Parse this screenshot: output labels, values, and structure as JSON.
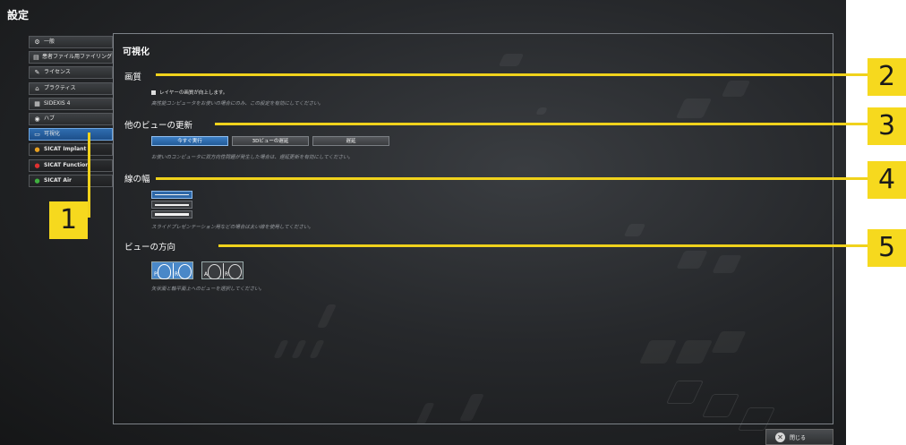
{
  "window_title": "設定",
  "sidebar": {
    "items": [
      {
        "label": "一般",
        "icon": "gear-icon"
      },
      {
        "label": "患者ファイル用ファイリング",
        "icon": "filing-icon"
      },
      {
        "label": "ライセンス",
        "icon": "license-icon"
      },
      {
        "label": "プラクティス",
        "icon": "home-icon"
      },
      {
        "label": "SIDEXIS 4",
        "icon": "sidexis-icon"
      },
      {
        "label": "ハブ",
        "icon": "hub-icon"
      },
      {
        "label": "可視化",
        "icon": "monitor-icon"
      },
      {
        "label": "SICAT Implant",
        "icon": "implant-icon",
        "color": "#e8a020"
      },
      {
        "label": "SICAT Function",
        "icon": "function-icon",
        "color": "#e03030"
      },
      {
        "label": "SICAT Air",
        "icon": "air-icon",
        "color": "#40b040"
      }
    ],
    "active_index": 6
  },
  "panel": {
    "title": "可視化",
    "quality": {
      "heading": "画質",
      "checkbox_label": "レイヤーの画質が向上します。",
      "hint": "高性能コンピュータをお使いの場合にのみ、この設定を有効にしてください。"
    },
    "update": {
      "heading": "他のビューの更新",
      "buttons": [
        "今すぐ実行",
        "3Dビューの遅延",
        "遅延"
      ],
      "selected": 0,
      "hint": "お使いのコンピュータに双方向性問題が発生した場合は、遅延更新を有効にしてください。"
    },
    "line_width": {
      "heading": "線の幅",
      "hint": "スライドプレゼンテーション用などの場合は太い線を使用してください。"
    },
    "orientation": {
      "heading": "ビューの方向",
      "hint": "矢状面と軸平面上へのビューを選択してください。",
      "letters_a": [
        "P",
        "R"
      ],
      "letters_b": [
        "A",
        "R"
      ]
    }
  },
  "close_button": {
    "label": "閉じる"
  },
  "callouts": [
    "1",
    "2",
    "3",
    "4",
    "5"
  ],
  "accent_color": "#f6d91e"
}
